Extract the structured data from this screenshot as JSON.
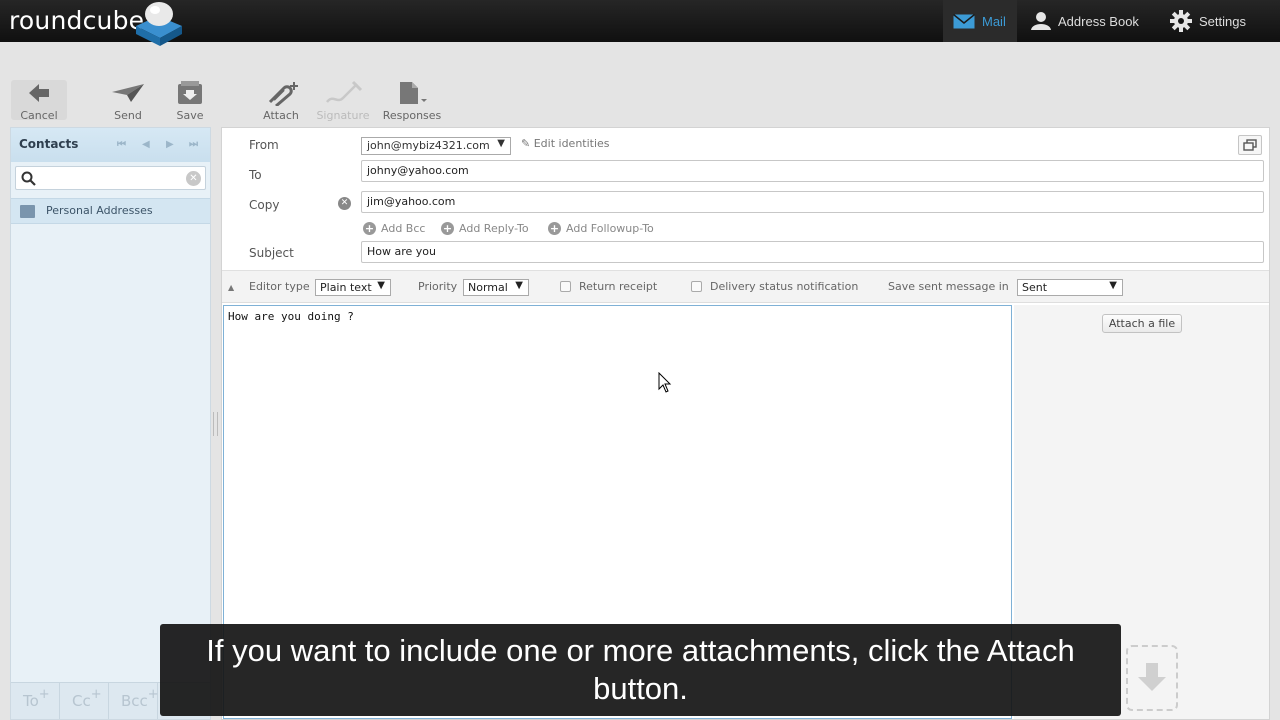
{
  "app": {
    "logo_text": "roundcube"
  },
  "topnav": {
    "mail": "Mail",
    "address_book": "Address Book",
    "settings": "Settings"
  },
  "toolbar": {
    "cancel": "Cancel",
    "send": "Send",
    "save": "Save",
    "attach": "Attach",
    "signature": "Signature",
    "responses": "Responses"
  },
  "contacts": {
    "title": "Contacts",
    "search_placeholder": "",
    "items": [
      {
        "label": "Personal Addresses"
      }
    ],
    "recipient_buttons": [
      "To",
      "Cc",
      "Bcc"
    ]
  },
  "compose": {
    "from_label": "From",
    "from_value": "john@mybiz4321.com",
    "edit_identities": "Edit identities",
    "to_label": "To",
    "to_value": "johny@yahoo.com",
    "copy_label": "Copy",
    "copy_value": "jim@yahoo.com",
    "add_bcc": "Add Bcc",
    "add_reply_to": "Add Reply-To",
    "add_followup_to": "Add Followup-To",
    "subject_label": "Subject",
    "subject_value": "How are you",
    "body": "How are you doing ?"
  },
  "options": {
    "editor_type_label": "Editor type",
    "editor_type_value": "Plain text",
    "priority_label": "Priority",
    "priority_value": "Normal",
    "return_receipt": "Return receipt",
    "delivery_status": "Delivery status notification",
    "save_sent_label": "Save sent message in",
    "save_sent_value": "Sent"
  },
  "attachments": {
    "attach_file_button": "Attach a file"
  },
  "caption": {
    "text": "If you want to include one or more attachments, click the Attach button."
  },
  "colors": {
    "accent": "#3c9bd6",
    "topbar": "#1a1a1a",
    "panel_bg": "#e8f1f7"
  }
}
